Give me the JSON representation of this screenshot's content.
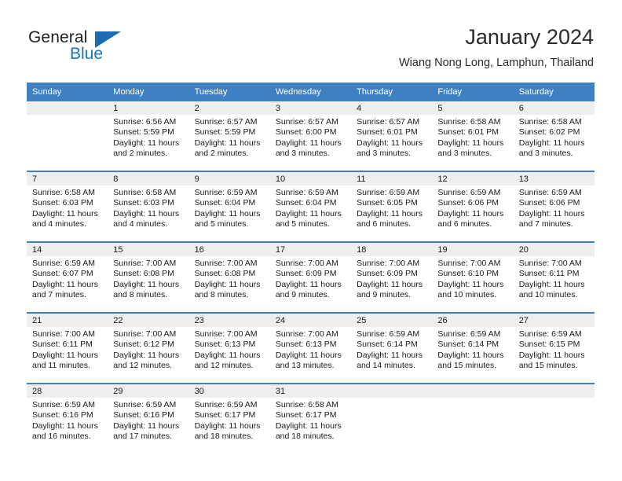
{
  "brand": {
    "name_part1": "General",
    "name_part2": "Blue",
    "logo_icon": "triangle-logo-icon"
  },
  "header": {
    "title": "January 2024",
    "subtitle": "Wiang Nong Long, Lamphun, Thailand"
  },
  "colors": {
    "header_blue": "#3f80c2",
    "brand_blue": "#1b75bb",
    "day_band_gray": "#eeeeee",
    "text": "#1a1a1a"
  },
  "weekdays": [
    "Sunday",
    "Monday",
    "Tuesday",
    "Wednesday",
    "Thursday",
    "Friday",
    "Saturday"
  ],
  "weeks": [
    [
      {
        "day": "",
        "sunrise": "",
        "sunset": "",
        "daylight_line1": "",
        "daylight_line2": ""
      },
      {
        "day": "1",
        "sunrise": "Sunrise: 6:56 AM",
        "sunset": "Sunset: 5:59 PM",
        "daylight_line1": "Daylight: 11 hours",
        "daylight_line2": "and 2 minutes."
      },
      {
        "day": "2",
        "sunrise": "Sunrise: 6:57 AM",
        "sunset": "Sunset: 5:59 PM",
        "daylight_line1": "Daylight: 11 hours",
        "daylight_line2": "and 2 minutes."
      },
      {
        "day": "3",
        "sunrise": "Sunrise: 6:57 AM",
        "sunset": "Sunset: 6:00 PM",
        "daylight_line1": "Daylight: 11 hours",
        "daylight_line2": "and 3 minutes."
      },
      {
        "day": "4",
        "sunrise": "Sunrise: 6:57 AM",
        "sunset": "Sunset: 6:01 PM",
        "daylight_line1": "Daylight: 11 hours",
        "daylight_line2": "and 3 minutes."
      },
      {
        "day": "5",
        "sunrise": "Sunrise: 6:58 AM",
        "sunset": "Sunset: 6:01 PM",
        "daylight_line1": "Daylight: 11 hours",
        "daylight_line2": "and 3 minutes."
      },
      {
        "day": "6",
        "sunrise": "Sunrise: 6:58 AM",
        "sunset": "Sunset: 6:02 PM",
        "daylight_line1": "Daylight: 11 hours",
        "daylight_line2": "and 3 minutes."
      }
    ],
    [
      {
        "day": "7",
        "sunrise": "Sunrise: 6:58 AM",
        "sunset": "Sunset: 6:03 PM",
        "daylight_line1": "Daylight: 11 hours",
        "daylight_line2": "and 4 minutes."
      },
      {
        "day": "8",
        "sunrise": "Sunrise: 6:58 AM",
        "sunset": "Sunset: 6:03 PM",
        "daylight_line1": "Daylight: 11 hours",
        "daylight_line2": "and 4 minutes."
      },
      {
        "day": "9",
        "sunrise": "Sunrise: 6:59 AM",
        "sunset": "Sunset: 6:04 PM",
        "daylight_line1": "Daylight: 11 hours",
        "daylight_line2": "and 5 minutes."
      },
      {
        "day": "10",
        "sunrise": "Sunrise: 6:59 AM",
        "sunset": "Sunset: 6:04 PM",
        "daylight_line1": "Daylight: 11 hours",
        "daylight_line2": "and 5 minutes."
      },
      {
        "day": "11",
        "sunrise": "Sunrise: 6:59 AM",
        "sunset": "Sunset: 6:05 PM",
        "daylight_line1": "Daylight: 11 hours",
        "daylight_line2": "and 6 minutes."
      },
      {
        "day": "12",
        "sunrise": "Sunrise: 6:59 AM",
        "sunset": "Sunset: 6:06 PM",
        "daylight_line1": "Daylight: 11 hours",
        "daylight_line2": "and 6 minutes."
      },
      {
        "day": "13",
        "sunrise": "Sunrise: 6:59 AM",
        "sunset": "Sunset: 6:06 PM",
        "daylight_line1": "Daylight: 11 hours",
        "daylight_line2": "and 7 minutes."
      }
    ],
    [
      {
        "day": "14",
        "sunrise": "Sunrise: 6:59 AM",
        "sunset": "Sunset: 6:07 PM",
        "daylight_line1": "Daylight: 11 hours",
        "daylight_line2": "and 7 minutes."
      },
      {
        "day": "15",
        "sunrise": "Sunrise: 7:00 AM",
        "sunset": "Sunset: 6:08 PM",
        "daylight_line1": "Daylight: 11 hours",
        "daylight_line2": "and 8 minutes."
      },
      {
        "day": "16",
        "sunrise": "Sunrise: 7:00 AM",
        "sunset": "Sunset: 6:08 PM",
        "daylight_line1": "Daylight: 11 hours",
        "daylight_line2": "and 8 minutes."
      },
      {
        "day": "17",
        "sunrise": "Sunrise: 7:00 AM",
        "sunset": "Sunset: 6:09 PM",
        "daylight_line1": "Daylight: 11 hours",
        "daylight_line2": "and 9 minutes."
      },
      {
        "day": "18",
        "sunrise": "Sunrise: 7:00 AM",
        "sunset": "Sunset: 6:09 PM",
        "daylight_line1": "Daylight: 11 hours",
        "daylight_line2": "and 9 minutes."
      },
      {
        "day": "19",
        "sunrise": "Sunrise: 7:00 AM",
        "sunset": "Sunset: 6:10 PM",
        "daylight_line1": "Daylight: 11 hours",
        "daylight_line2": "and 10 minutes."
      },
      {
        "day": "20",
        "sunrise": "Sunrise: 7:00 AM",
        "sunset": "Sunset: 6:11 PM",
        "daylight_line1": "Daylight: 11 hours",
        "daylight_line2": "and 10 minutes."
      }
    ],
    [
      {
        "day": "21",
        "sunrise": "Sunrise: 7:00 AM",
        "sunset": "Sunset: 6:11 PM",
        "daylight_line1": "Daylight: 11 hours",
        "daylight_line2": "and 11 minutes."
      },
      {
        "day": "22",
        "sunrise": "Sunrise: 7:00 AM",
        "sunset": "Sunset: 6:12 PM",
        "daylight_line1": "Daylight: 11 hours",
        "daylight_line2": "and 12 minutes."
      },
      {
        "day": "23",
        "sunrise": "Sunrise: 7:00 AM",
        "sunset": "Sunset: 6:13 PM",
        "daylight_line1": "Daylight: 11 hours",
        "daylight_line2": "and 12 minutes."
      },
      {
        "day": "24",
        "sunrise": "Sunrise: 7:00 AM",
        "sunset": "Sunset: 6:13 PM",
        "daylight_line1": "Daylight: 11 hours",
        "daylight_line2": "and 13 minutes."
      },
      {
        "day": "25",
        "sunrise": "Sunrise: 6:59 AM",
        "sunset": "Sunset: 6:14 PM",
        "daylight_line1": "Daylight: 11 hours",
        "daylight_line2": "and 14 minutes."
      },
      {
        "day": "26",
        "sunrise": "Sunrise: 6:59 AM",
        "sunset": "Sunset: 6:14 PM",
        "daylight_line1": "Daylight: 11 hours",
        "daylight_line2": "and 15 minutes."
      },
      {
        "day": "27",
        "sunrise": "Sunrise: 6:59 AM",
        "sunset": "Sunset: 6:15 PM",
        "daylight_line1": "Daylight: 11 hours",
        "daylight_line2": "and 15 minutes."
      }
    ],
    [
      {
        "day": "28",
        "sunrise": "Sunrise: 6:59 AM",
        "sunset": "Sunset: 6:16 PM",
        "daylight_line1": "Daylight: 11 hours",
        "daylight_line2": "and 16 minutes."
      },
      {
        "day": "29",
        "sunrise": "Sunrise: 6:59 AM",
        "sunset": "Sunset: 6:16 PM",
        "daylight_line1": "Daylight: 11 hours",
        "daylight_line2": "and 17 minutes."
      },
      {
        "day": "30",
        "sunrise": "Sunrise: 6:59 AM",
        "sunset": "Sunset: 6:17 PM",
        "daylight_line1": "Daylight: 11 hours",
        "daylight_line2": "and 18 minutes."
      },
      {
        "day": "31",
        "sunrise": "Sunrise: 6:58 AM",
        "sunset": "Sunset: 6:17 PM",
        "daylight_line1": "Daylight: 11 hours",
        "daylight_line2": "and 18 minutes."
      },
      {
        "day": "",
        "sunrise": "",
        "sunset": "",
        "daylight_line1": "",
        "daylight_line2": ""
      },
      {
        "day": "",
        "sunrise": "",
        "sunset": "",
        "daylight_line1": "",
        "daylight_line2": ""
      },
      {
        "day": "",
        "sunrise": "",
        "sunset": "",
        "daylight_line1": "",
        "daylight_line2": ""
      }
    ]
  ]
}
